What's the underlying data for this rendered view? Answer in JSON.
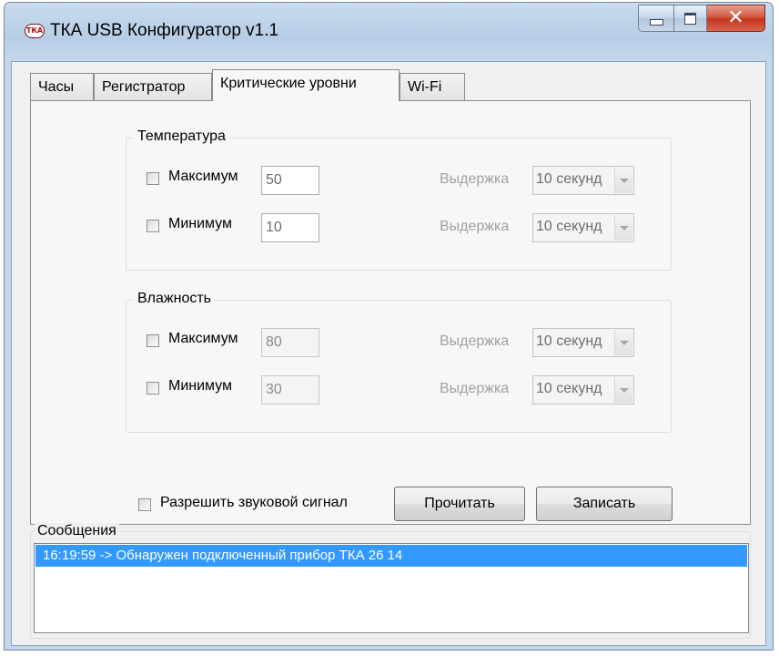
{
  "window": {
    "title": "ТКА USB Конфигуратор v1.1",
    "icon_text": "ТКА",
    "close_glyph": "✕"
  },
  "tabs": [
    {
      "label": "Часы"
    },
    {
      "label": "Регистратор"
    },
    {
      "label": "Критические уровни",
      "active": true
    },
    {
      "label": "Wi-Fi"
    }
  ],
  "temperature": {
    "title": "Температура",
    "max": {
      "label": "Максимум",
      "checked": false,
      "value": "50",
      "hold_label": "Выдержка",
      "hold_value": "10 секунд"
    },
    "min": {
      "label": "Минимум",
      "checked": false,
      "value": "10",
      "hold_label": "Выдержка",
      "hold_value": "10 секунд"
    }
  },
  "humidity": {
    "title": "Влажность",
    "max": {
      "label": "Максимум",
      "checked": false,
      "value": "80",
      "hold_label": "Выдержка",
      "hold_value": "10 секунд"
    },
    "min": {
      "label": "Минимум",
      "checked": false,
      "value": "30",
      "hold_label": "Выдержка",
      "hold_value": "10 секунд"
    }
  },
  "sound": {
    "label": "Разрешить звуковой сигнал",
    "checked": false
  },
  "buttons": {
    "read": "Прочитать",
    "write": "Записать"
  },
  "messages": {
    "title": "Сообщения",
    "items": [
      "16:19:59 -> Обнаружен подключенный прибор ТКА 26 14"
    ]
  },
  "colors": {
    "selection": "#3399ff",
    "close_button": "#c2341d"
  }
}
